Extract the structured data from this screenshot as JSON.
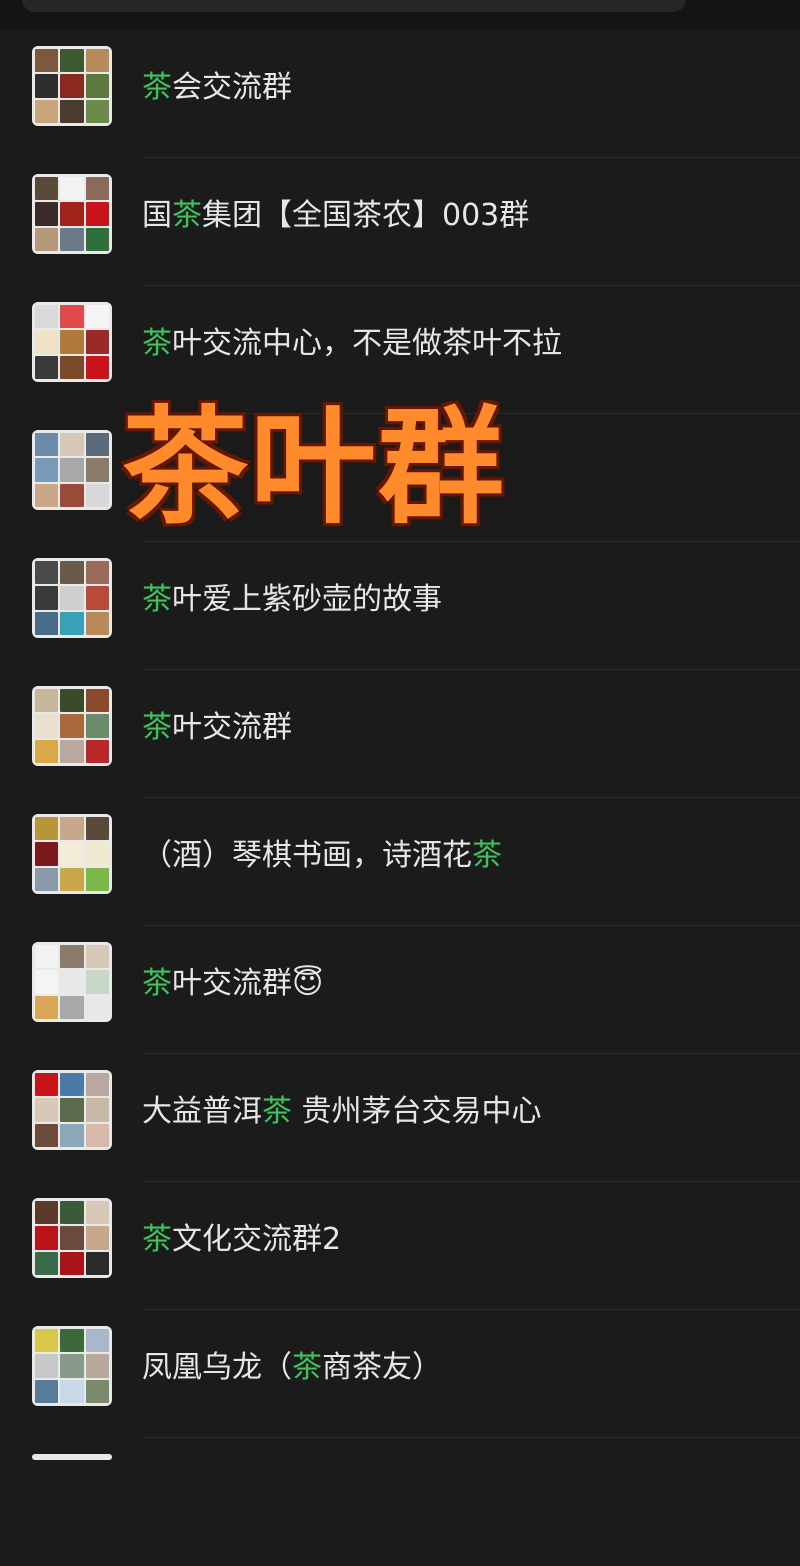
{
  "overlay": {
    "title": "茶叶群"
  },
  "groups": [
    {
      "pre": "",
      "hl": "茶",
      "post": "会交流群",
      "emoji": ""
    },
    {
      "pre": "国",
      "hl": "茶",
      "post": "集团【全国茶农】003群",
      "emoji": ""
    },
    {
      "pre": "",
      "hl": "茶",
      "post": "叶交流中心，不是做茶叶不拉",
      "emoji": ""
    },
    {
      "pre": "",
      "hl": "",
      "post": "",
      "emoji": ""
    },
    {
      "pre": "",
      "hl": "茶",
      "post": "叶爱上紫砂壶的故事",
      "emoji": ""
    },
    {
      "pre": "",
      "hl": "茶",
      "post": "叶交流群",
      "emoji": ""
    },
    {
      "pre": "（酒）琴棋书画，诗酒花",
      "hl": "茶",
      "post": "",
      "emoji": ""
    },
    {
      "pre": "",
      "hl": "茶",
      "post": "叶交流群",
      "emoji": "😇"
    },
    {
      "pre": "大益普洱",
      "hl": "茶",
      "post": " 贵州茅台交易中心",
      "emoji": ""
    },
    {
      "pre": "",
      "hl": "茶",
      "post": "文化交流群2",
      "emoji": ""
    },
    {
      "pre": "凤凰乌龙（",
      "hl": "茶",
      "post": "商茶友）",
      "emoji": ""
    }
  ],
  "colors": {
    "background": "#1b1b1b",
    "highlight": "#3fc15b",
    "overlay": "#ff8a2b"
  }
}
